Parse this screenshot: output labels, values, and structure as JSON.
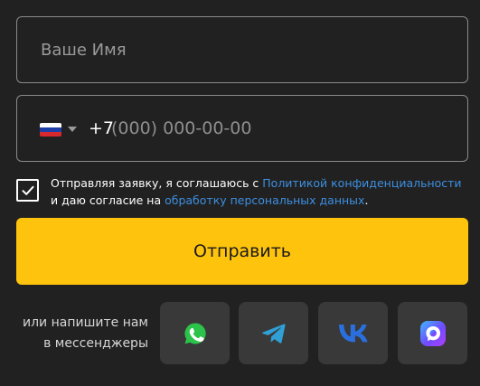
{
  "form": {
    "name_placeholder": "Ваше Имя",
    "phone_code": "+7",
    "phone_placeholder": "(000) 000-00-00",
    "country_flag": "russia-flag",
    "consent": {
      "checked": true,
      "text_1": "Отправляя заявку, я соглашаюсь с ",
      "link_1": "Политикой конфиденциальности",
      "text_2": " и даю согласие на ",
      "link_2": "обработку персональных данных",
      "text_3": "."
    },
    "submit_label": "Отправить"
  },
  "messengers": {
    "line_1": "или напишите нам",
    "line_2": "в мессенджеры",
    "items": [
      {
        "icon": "whatsapp-icon",
        "color": "#2cc34a"
      },
      {
        "icon": "telegram-icon",
        "color": "#2f9fd6"
      },
      {
        "icon": "vk-icon",
        "color": "#2a6fde"
      },
      {
        "icon": "max-messenger-icon",
        "color": "#6f4bff"
      }
    ]
  },
  "colors": {
    "background": "#212121",
    "accent": "#fec40d",
    "link": "#3d8fe0",
    "button_bg": "#393939"
  }
}
